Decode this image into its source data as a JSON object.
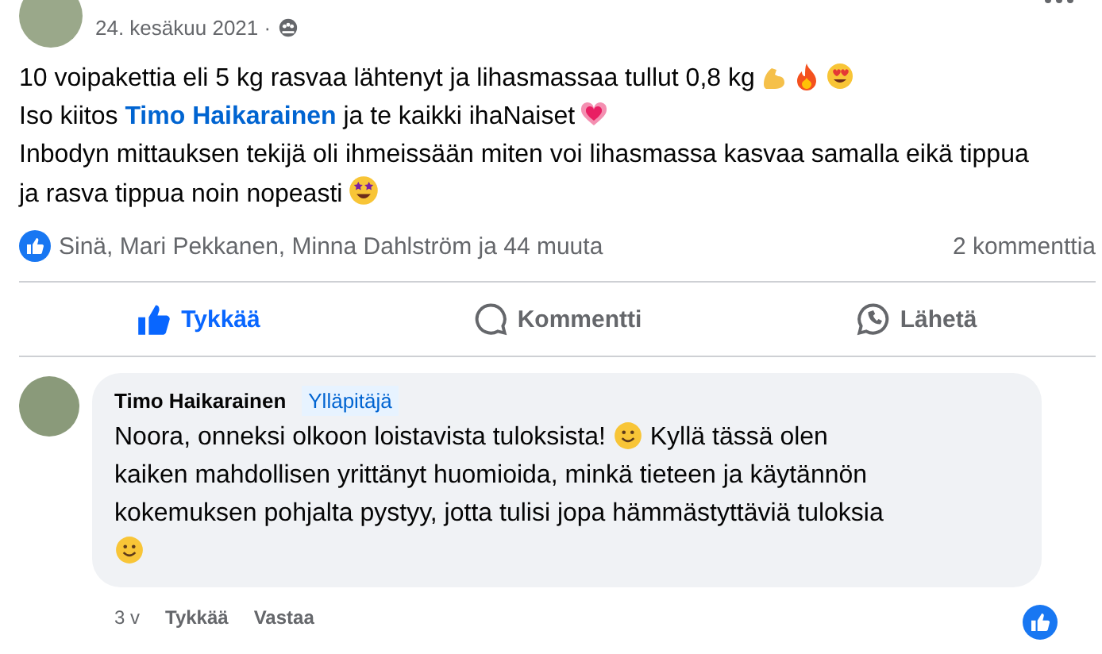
{
  "post": {
    "date": "24. kesäkuu 2021 ·",
    "lines": [
      {
        "parts": [
          {
            "kind": "text",
            "text": "10 voipakettia eli 5 kg rasvaa lähtenyt ja lihasmassaa tullut 0,8 kg"
          },
          {
            "kind": "muscle"
          },
          {
            "kind": "fire"
          },
          {
            "kind": "heart-eyes"
          }
        ]
      },
      {
        "parts": [
          {
            "kind": "text",
            "text": "Iso kiitos "
          },
          {
            "kind": "mention",
            "text": "Timo Haikarainen"
          },
          {
            "kind": "text",
            "text": " ja te kaikki ihaNaiset"
          },
          {
            "kind": "heart"
          }
        ]
      },
      {
        "parts": [
          {
            "kind": "text",
            "text": "Inbodyn mittauksen tekijä oli ihmeissään miten voi lihasmassa kasvaa samalla eikä tippua ja rasva tippua noin nopeasti"
          },
          {
            "kind": "star-eyes"
          }
        ]
      }
    ],
    "reactions": "Sinä, Mari Pekkanen, Minna Dahlström ja 44 muuta",
    "comment_count": "2 kommenttia",
    "actions": [
      {
        "kind": "like",
        "label": "Tykkää",
        "selected": true
      },
      {
        "kind": "comment",
        "label": "Kommentti",
        "selected": false
      },
      {
        "kind": "share",
        "label": "Lähetä",
        "selected": false
      }
    ]
  },
  "comment": {
    "author": "Timo Haikarainen",
    "badge": "Ylläpitäjä",
    "parts": [
      {
        "kind": "text",
        "text": "Noora, onneksi olkoon loistavista tuloksista! "
      },
      {
        "kind": "smile"
      },
      {
        "kind": "text",
        "text": " Kyllä tässä olen kaiken mahdollisen yrittänyt huomioida, minkä tieteen ja käytännön kokemuksen pohjalta pystyy, jotta tulisi jopa hämmästyttäviä tuloksia "
      },
      {
        "kind": "smile"
      }
    ],
    "age": "3 v",
    "like": "Tykkää",
    "reply": "Vastaa"
  }
}
